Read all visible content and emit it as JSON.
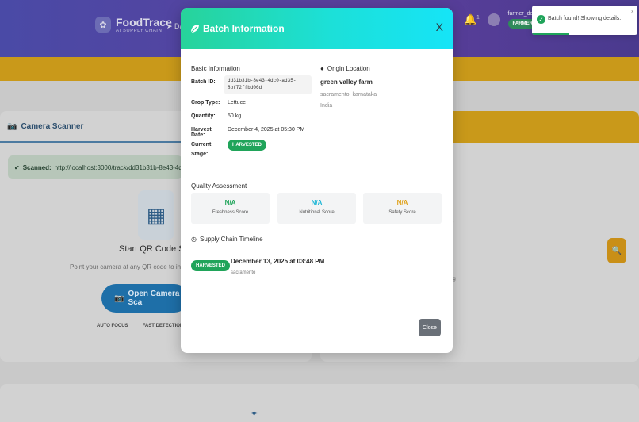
{
  "app": {
    "name": "FoodTrace",
    "tagline": "AI SUPPLY CHAIN",
    "nav_partial": "Da",
    "notification_count": "1",
    "user_name": "farmer_demo",
    "user_role": "FARMER"
  },
  "background": {
    "scanner_title": "Camera Scanner",
    "scanned_label": "Scanned:",
    "scanned_url": "http://localhost:3000/track/dd31b31b-8e43-4dc0-ad35-",
    "start_scan": "Start QR Code Scann",
    "point_text": "Point your camera at any QR code to instantly",
    "open_camera": "Open Camera Sca",
    "chips": [
      "AUTO FOCUS",
      "FAST DETECTION"
    ],
    "right_frag_1": "e",
    "right_frag_2": "ng"
  },
  "modal": {
    "title": "Batch Information",
    "close_x": "X",
    "basic_info_title": "Basic Information",
    "fields": {
      "batch_id_label": "Batch ID:",
      "batch_id_value": "dd31b31b-8e43-4dc0-ad35-8bf72ffbd06d",
      "crop_type_label": "Crop Type:",
      "crop_type_value": "Lettuce",
      "quantity_label": "Quantity:",
      "quantity_value": "50 kg",
      "harvest_date_label": "Harvest Date:",
      "harvest_date_value": "December 4, 2025 at 05:30 PM",
      "current_stage_label": "Current Stage:",
      "current_stage_value": "HARVESTED"
    },
    "origin": {
      "title": "Origin Location",
      "farm_name": "green valley farm",
      "region": "sacramento, karnataka",
      "country": "India"
    },
    "quality": {
      "title": "Quality Assessment",
      "scores": [
        {
          "value": "N/A",
          "label": "Freshness Score",
          "color": "#20a45a"
        },
        {
          "value": "N/A",
          "label": "Nutritional Score",
          "color": "#1cb6d6"
        },
        {
          "value": "N/A",
          "label": "Safety Score",
          "color": "#e0a21a"
        }
      ]
    },
    "timeline": {
      "title": "Supply Chain Timeline",
      "events": [
        {
          "stage": "HARVESTED",
          "date": "December 13, 2025 at 03:48 PM",
          "location": "sacramento"
        }
      ]
    },
    "close_button": "Close"
  },
  "toast": {
    "message": "Batch found! Showing details.",
    "close": "X",
    "progress": 0.35
  }
}
